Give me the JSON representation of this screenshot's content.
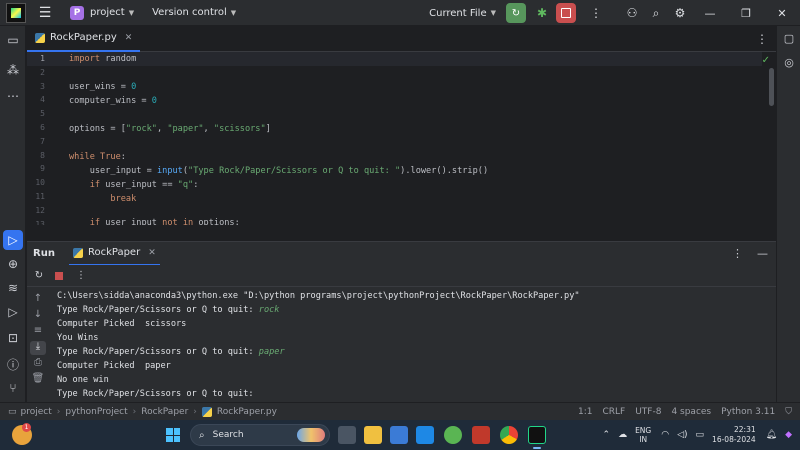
{
  "titlebar": {
    "project_badge": "P",
    "project_name": "project",
    "version_control": "Version control",
    "current_file": "Current File"
  },
  "editor": {
    "tab_label": "RockPaper.py",
    "line_numbers": [
      "1",
      "2",
      "3",
      "4",
      "5",
      "6",
      "7",
      "8",
      "9",
      "10",
      "11",
      "12",
      "13"
    ]
  },
  "run": {
    "title": "Run",
    "tab_label": "RockPaper",
    "console_lines": [
      "C:\\Users\\sidda\\anaconda3\\python.exe \"D:\\python programs\\project\\pythonProject\\RockPaper\\RockPaper.py\"",
      "Type Rock/Paper/Scissors or Q to quit: ",
      "Computer Picked  scissors",
      "You Wins",
      "Type Rock/Paper/Scissors or Q to quit: ",
      "Computer Picked  paper",
      "No one win",
      "Type Rock/Paper/Scissors or Q to quit: "
    ],
    "user_inputs": [
      "rock",
      "paper"
    ]
  },
  "statusbar": {
    "breadcrumb": [
      "project",
      "pythonProject",
      "RockPaper",
      "RockPaper.py"
    ],
    "position": "1:1",
    "line_ending": "CRLF",
    "encoding": "UTF-8",
    "indent": "4 spaces",
    "interpreter": "Python 3.11"
  },
  "taskbar": {
    "weather_badge": "1",
    "search_label": "Search",
    "lang_top": "ENG",
    "lang_bottom": "IN",
    "time": "22:31",
    "date": "16-08-2024"
  },
  "colors": {
    "accent": "#3574f0",
    "run_green": "#57965c",
    "stop_red": "#c94f4f",
    "keyword": "#cf8e6d",
    "string": "#6aab73",
    "number": "#2aacb8"
  }
}
